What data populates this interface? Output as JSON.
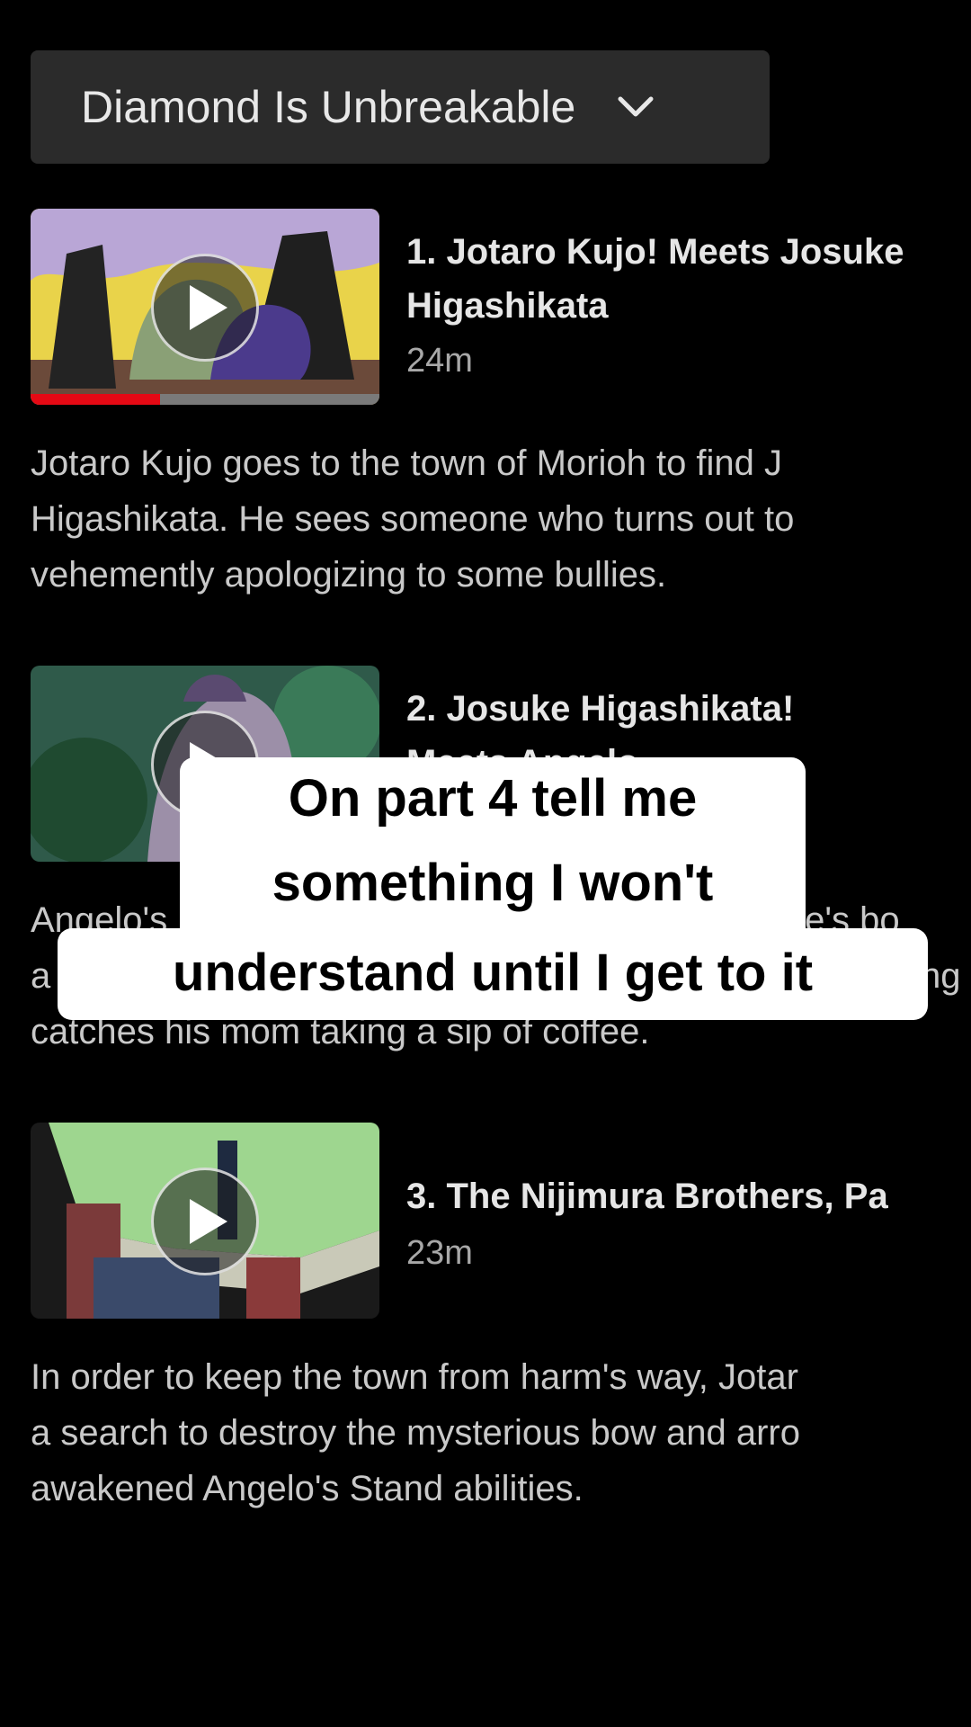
{
  "season_selector": {
    "label": "Diamond Is Unbreakable",
    "icon": "chevron-down-icon"
  },
  "episodes": [
    {
      "title_line1": "1. Jotaro Kujo! Meets Josuke",
      "title_line2": "Higashikata",
      "duration": "24m",
      "watched_fraction": 0.37,
      "description_lines": [
        "Jotaro Kujo goes to the town of Morioh to find J",
        "Higashikata. He sees someone who turns out to",
        "vehemently apologizing to some bullies."
      ]
    },
    {
      "title_line1": "2. Josuke Higashikata!",
      "title_line2": "Meets Angelo",
      "duration": "",
      "description_lines": [
        "Angelo's",
        "a",
        "catches his mom taking a sip of coffee."
      ],
      "description_right_fragments": [
        "ple's bo",
        "ng"
      ]
    },
    {
      "title_line1": "3. The Nijimura Brothers, Pa",
      "title_line2": "",
      "duration": "23m",
      "description_lines": [
        "In order to keep the town from harm's way, Jotar",
        "a search to destroy the mysterious bow and arro",
        "awakened Angelo's Stand abilities."
      ]
    }
  ],
  "caption": {
    "line1": "On part 4 tell me",
    "line2": "something I won't",
    "line3": "understand until I get to it"
  },
  "colors": {
    "background": "#000000",
    "selector_bg": "#2b2b2b",
    "progress_red": "#e50914"
  }
}
